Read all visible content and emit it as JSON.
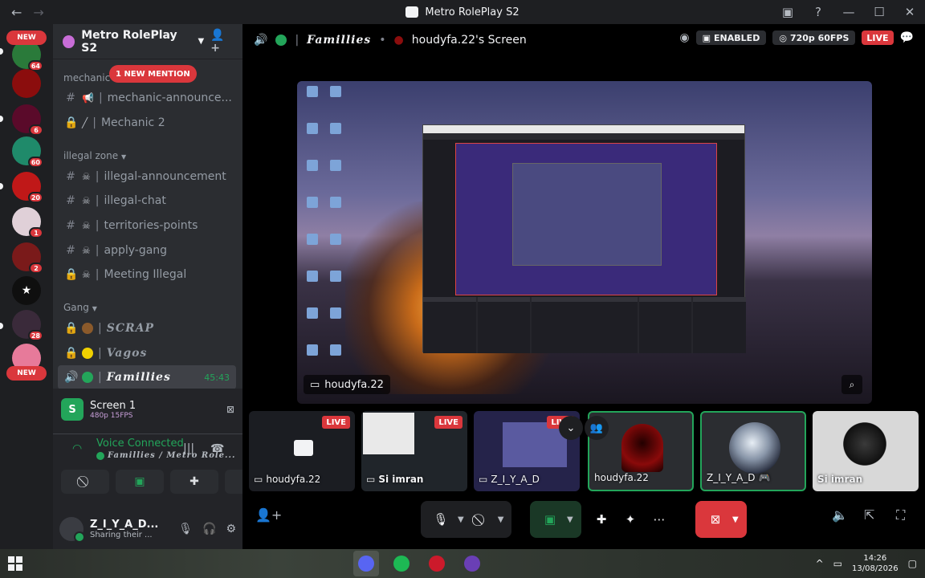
{
  "titlebar": {
    "title": "Metro RolePlay S2"
  },
  "guilds": [
    {
      "badge": "64"
    },
    {
      "badge": ""
    },
    {
      "badge": "6"
    },
    {
      "badge": "60"
    },
    {
      "badge": "20"
    },
    {
      "badge": "1"
    },
    {
      "badge": "2"
    },
    {
      "badge": ""
    },
    {
      "badge": "28"
    },
    {
      "badge": ""
    }
  ],
  "guild_new_label": "NEW",
  "sidebar": {
    "server_name": "Metro RolePlay S2",
    "mention_pill": "1 NEW MENTION",
    "cat_mechanic": "mechanic",
    "cat_illegal": "illegal zone",
    "cat_gang": "Gang",
    "channels": [
      {
        "name": "mechanic-announce...",
        "icon": "text-channel-icon"
      },
      {
        "name": "Mechanic 2",
        "icon": "lock-icon"
      },
      {
        "name": "illegal-announcement",
        "icon": "text-channel-icon"
      },
      {
        "name": "illegal-chat",
        "icon": "text-channel-icon"
      },
      {
        "name": "territories-points",
        "icon": "text-channel-icon"
      },
      {
        "name": "apply-gang",
        "icon": "text-channel-icon"
      },
      {
        "name": "Meeting Illegal",
        "icon": "lock-icon"
      },
      {
        "name": "SCRAP",
        "icon": "lock-icon"
      },
      {
        "name": "Vagos",
        "icon": "lock-icon"
      },
      {
        "name": "Famillies",
        "icon": "voice-channel-icon",
        "time": "45:43"
      }
    ]
  },
  "panel": {
    "screen_title": "Screen 1",
    "screen_quality": "480p 15FPS",
    "voice_status": "Voice Connected",
    "voice_channel": "Famillies / Metro Role...",
    "username": "Z_I_Y_A_D...",
    "user_status": "Sharing their ..."
  },
  "stage": {
    "channel": "Famillies",
    "stream_title": "houdyfa.22's Screen",
    "enabled_label": "ENABLED",
    "quality_label": "720p 60FPS",
    "live_label": "LIVE",
    "streamer_name": "houdyfa.22"
  },
  "tiles": [
    {
      "name": "houdyfa.22",
      "live": true
    },
    {
      "name": "Si imran",
      "live": true
    },
    {
      "name": "Z_I_Y_A_D",
      "live": true
    },
    {
      "name": "houdyfa.22",
      "live": false
    },
    {
      "name": "Z_I_Y_A_D",
      "live": false
    },
    {
      "name": "Si imran",
      "live": false
    }
  ],
  "tile_live_label": "LIVE",
  "taskbar": {
    "time": "14:26",
    "date": "13/08/2026"
  },
  "colors": {
    "accent_green": "#23a55a",
    "danger_red": "#da373c",
    "bg_dark": "#1e1f22"
  }
}
